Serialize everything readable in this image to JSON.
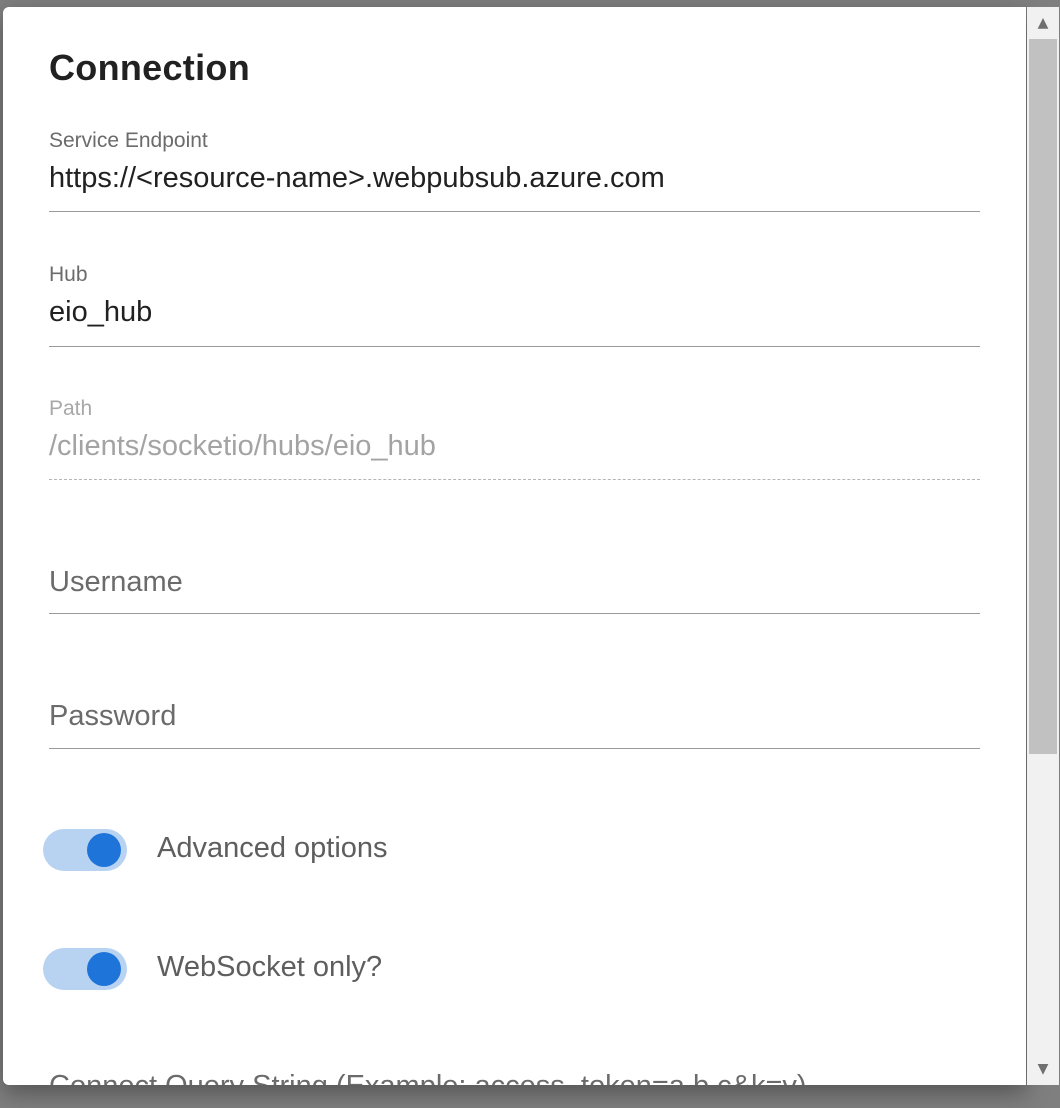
{
  "dialog": {
    "title": "Connection"
  },
  "fields": {
    "service_endpoint": {
      "label": "Service Endpoint",
      "value": "https://<resource-name>.webpubsub.azure.com"
    },
    "hub": {
      "label": "Hub",
      "value": "eio_hub"
    },
    "path": {
      "label": "Path",
      "value": "/clients/socketio/hubs/eio_hub"
    },
    "username": {
      "placeholder": "Username"
    },
    "password": {
      "placeholder": "Password"
    }
  },
  "toggles": {
    "advanced_options": {
      "label": "Advanced options",
      "checked": true
    },
    "websocket_only": {
      "label": "WebSocket only?",
      "checked": true
    }
  },
  "cutoff_label": "Connect Query String (Example: access_token=a.b.c&k=v)",
  "colors": {
    "switch_track": "#b7d3f1",
    "switch_knob": "#1e74d8"
  },
  "icons": {
    "scroll_up": "triangle-up",
    "scroll_down": "triangle-down"
  }
}
